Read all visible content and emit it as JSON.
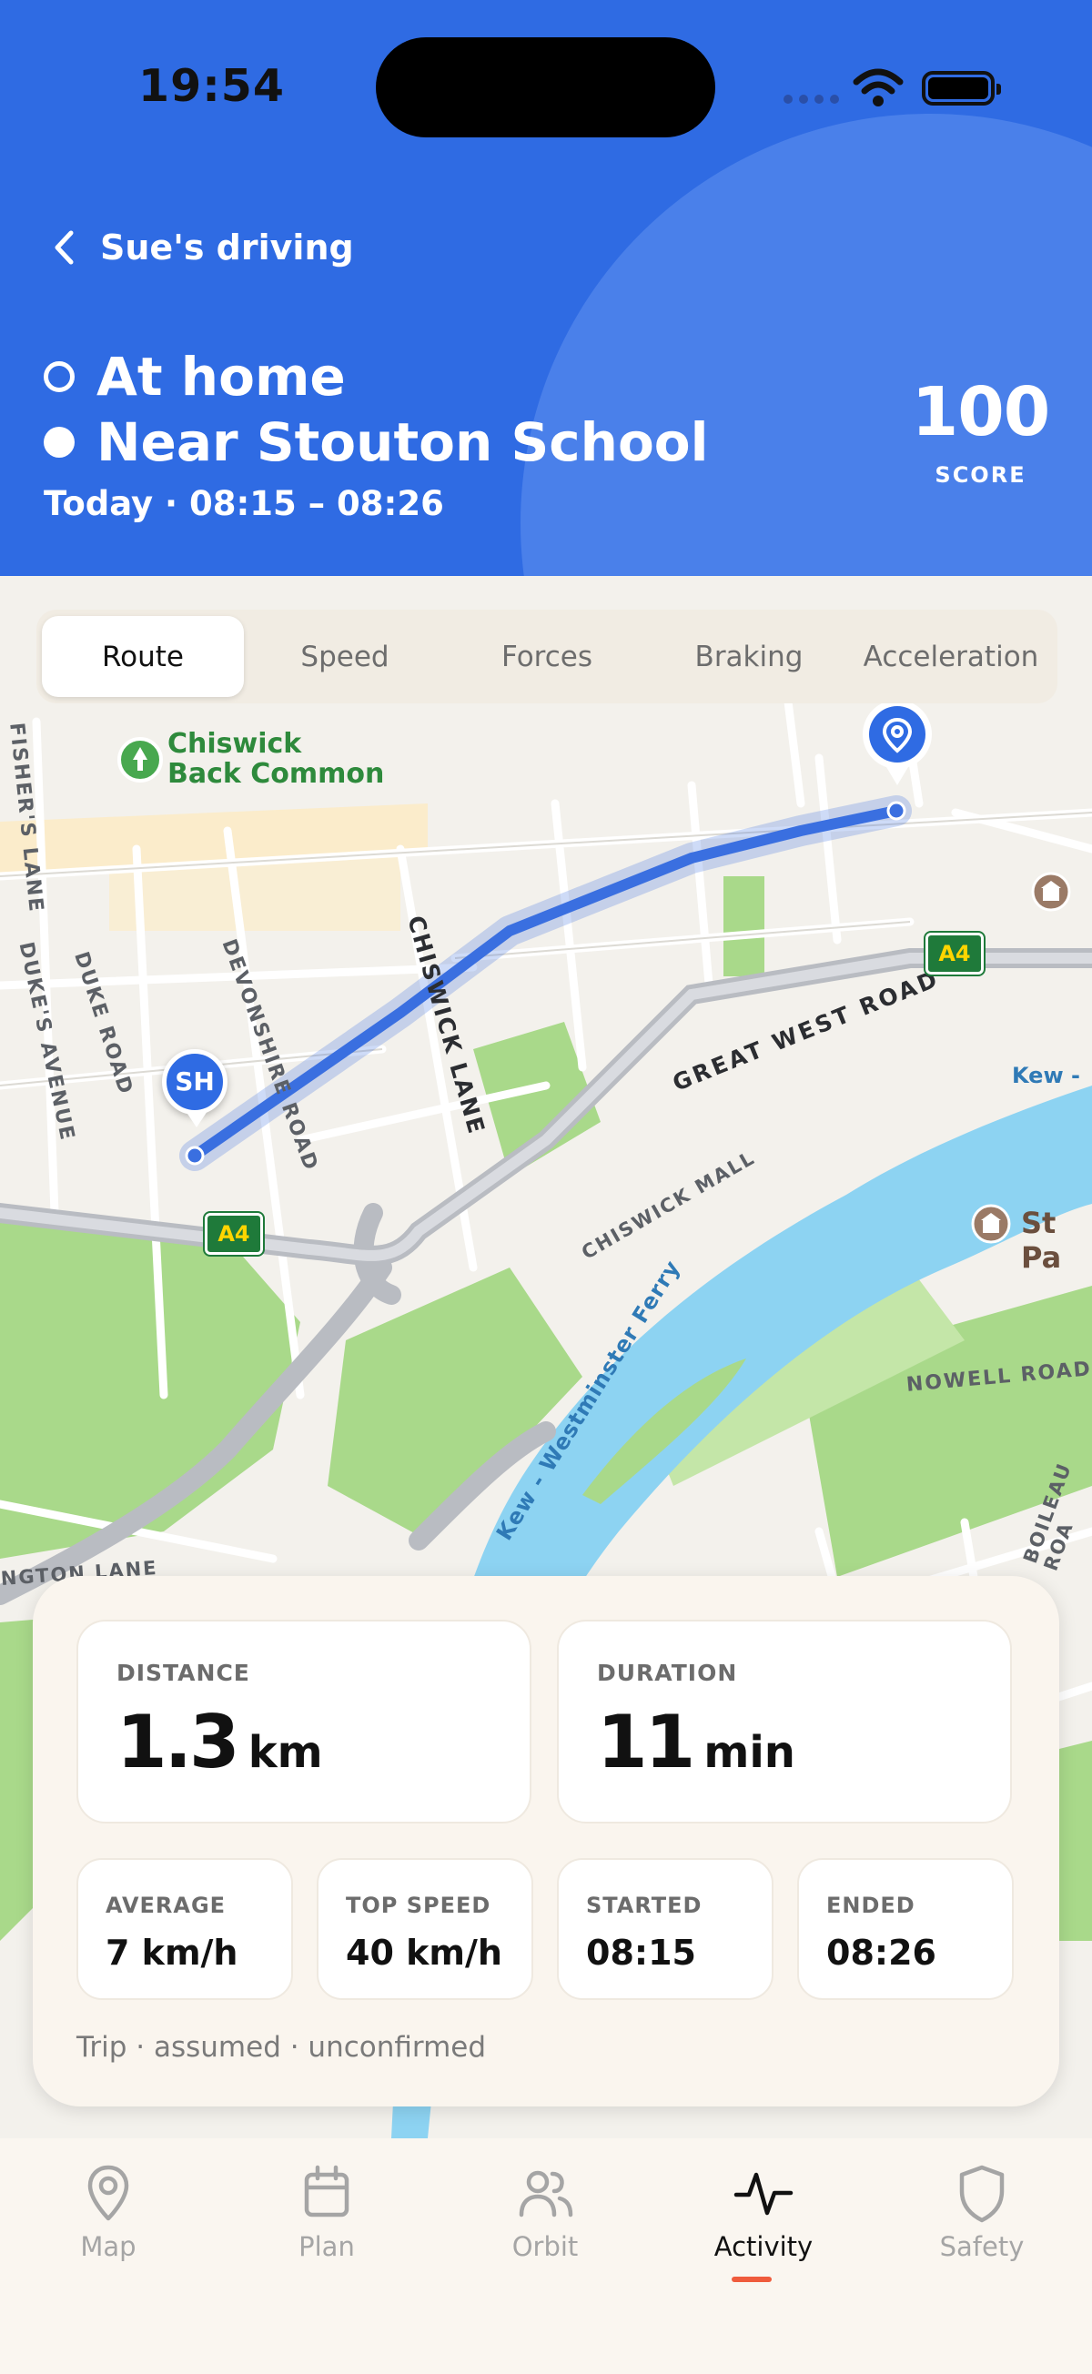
{
  "status_bar": {
    "time": "19:54"
  },
  "header": {
    "back_label": "Sue's driving",
    "from": "At home",
    "to": "Near Stouton School",
    "time_range": "Today · 08:15 – 08:26",
    "score_value": "100",
    "score_label": "SCORE"
  },
  "tabs": {
    "items": [
      {
        "label": "Route",
        "active": true
      },
      {
        "label": "Speed"
      },
      {
        "label": "Forces"
      },
      {
        "label": "Braking"
      },
      {
        "label": "Acceleration"
      }
    ]
  },
  "map": {
    "labels": {
      "chiswick_common": "Chiswick\nBack Common",
      "fishers_lane": "FISHER'S LANE",
      "dukes_avenue": "DUKE'S AVENUE",
      "duke_road": "DUKE ROAD",
      "devonshire_road": "DEVONSHIRE ROAD",
      "chiswick_lane": "CHISWICK LANE",
      "great_west_road": "GREAT WEST ROAD",
      "chiswick_mall": "CHISWICK MALL",
      "ferry": "Kew - Westminster Ferry",
      "nowell_road": "NOWELL ROAD",
      "boileau_road": "BOILEAU ROA",
      "kew_edge": "Kew -",
      "st_pa": "St Pa",
      "a4_1": "A4",
      "a4_2": "A4",
      "ngton_lane": "NGTON LANE",
      "start_marker": "SH"
    }
  },
  "stats": {
    "distance_label": "DISTANCE",
    "distance_value": "1.3",
    "distance_unit": "km",
    "duration_label": "DURATION",
    "duration_value": "11",
    "duration_unit": "min",
    "average_label": "AVERAGE",
    "average_value": "7 km/h",
    "top_speed_label": "TOP SPEED",
    "top_speed_value": "40 km/h",
    "started_label": "STARTED",
    "started_value": "08:15",
    "ended_label": "ENDED",
    "ended_value": "08:26",
    "note": "Trip · assumed · unconfirmed"
  },
  "tabbar": {
    "items": [
      {
        "label": "Map",
        "icon": "map-pin-icon"
      },
      {
        "label": "Plan",
        "icon": "calendar-icon"
      },
      {
        "label": "Orbit",
        "icon": "people-icon"
      },
      {
        "label": "Activity",
        "icon": "activity-icon",
        "active": true
      },
      {
        "label": "Safety",
        "icon": "shield-icon"
      }
    ]
  },
  "colors": {
    "header_blue": "#2f6be3",
    "route_blue": "#3a6fe0",
    "active_tab_underline": "#ef5b3c",
    "water": "#8dd3f2",
    "park": "#a9d98a"
  }
}
